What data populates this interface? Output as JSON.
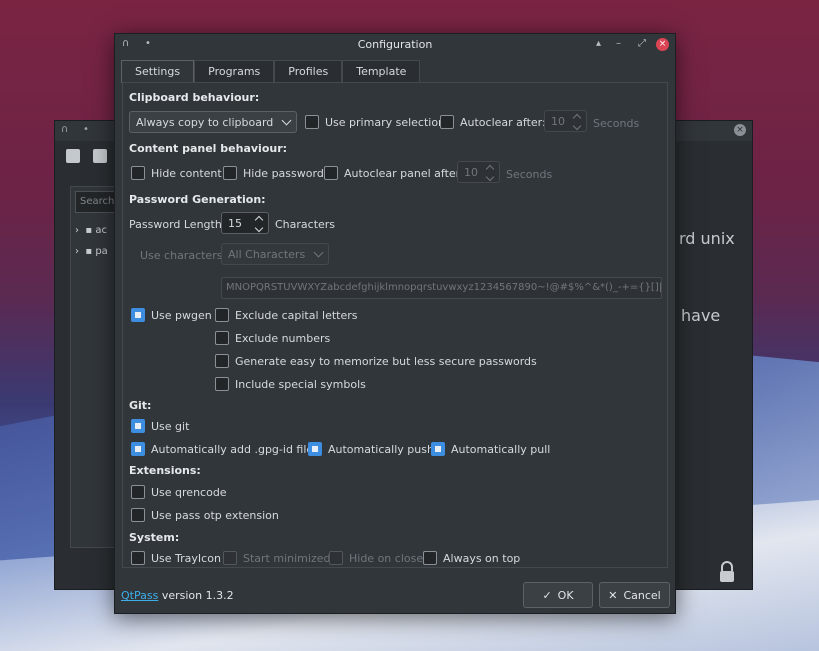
{
  "background_window": {
    "search_placeholder": "Search f",
    "tree_items": [
      "ac",
      "pa"
    ],
    "text_line1": "rd unix",
    "text_line2": "have"
  },
  "dialog": {
    "title": "Configuration",
    "tabs": [
      "Settings",
      "Programs",
      "Profiles",
      "Template"
    ],
    "active_tab": "Settings"
  },
  "clipboard": {
    "heading": "Clipboard behaviour:",
    "mode": "Always copy to clipboard",
    "use_primary_selection": "Use primary selection",
    "autoclear_after": "Autoclear after:",
    "autoclear_value": "10",
    "seconds": "Seconds"
  },
  "content_panel": {
    "heading": "Content panel behaviour:",
    "hide_content": "Hide content",
    "hide_password": "Hide password",
    "autoclear_panel_after": "Autoclear panel after:",
    "autoclear_value": "10",
    "seconds": "Seconds"
  },
  "password_generation": {
    "heading": "Password Generation:",
    "length_label": "Password Length:",
    "length_value": "15",
    "characters": "Characters",
    "use_characters_label": "Use characters:",
    "use_characters_value": "All Characters",
    "charset": "MNOPQRSTUVWXYZabcdefghijklmnopqrstuvwxyz1234567890~!@#$%^&*()_-+={}[]|:;<>,.?",
    "use_pwgen": "Use pwgen",
    "exclude_capital": "Exclude capital letters",
    "exclude_numbers": "Exclude numbers",
    "easy_to_memorize": "Generate easy to memorize but less secure passwords",
    "include_special": "Include special symbols"
  },
  "git": {
    "heading": "Git:",
    "use_git": "Use git",
    "auto_add_gpg_id": "Automatically add .gpg-id files",
    "auto_push": "Automatically push",
    "auto_pull": "Automatically pull"
  },
  "extensions": {
    "heading": "Extensions:",
    "use_qrencode": "Use qrencode",
    "use_pass_otp": "Use pass otp extension"
  },
  "system": {
    "heading": "System:",
    "use_trayicon": "Use TrayIcon",
    "start_minimized": "Start minimized",
    "hide_on_close": "Hide on close",
    "always_on_top": "Always on top"
  },
  "footer": {
    "app_link": "QtPass",
    "version_text": " version 1.3.2",
    "ok": "OK",
    "cancel": "Cancel"
  },
  "checked": {
    "use_primary_selection": false,
    "autoclear": false,
    "hide_content": false,
    "hide_password": false,
    "autoclear_panel": false,
    "use_pwgen": true,
    "exclude_capital": false,
    "exclude_numbers": false,
    "easy_to_memorize": false,
    "include_special": false,
    "use_git": true,
    "auto_add_gpg_id": true,
    "auto_push": true,
    "auto_pull": true,
    "use_qrencode": false,
    "use_pass_otp": false,
    "use_trayicon": false,
    "start_minimized": false,
    "hide_on_close": false,
    "always_on_top": false
  },
  "colors": {
    "accent": "#3d8de0",
    "window_bg": "#31363b",
    "close_button": "#da4453",
    "link": "#3daee9"
  }
}
